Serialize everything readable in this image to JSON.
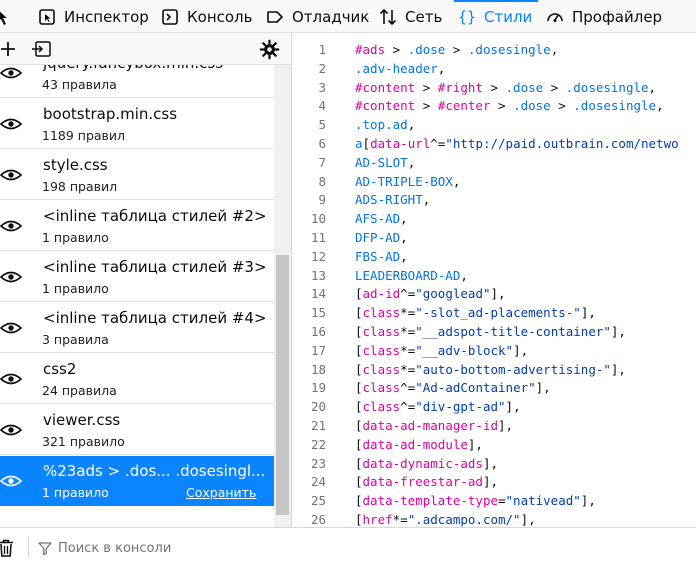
{
  "toolbar": {
    "tabs": [
      {
        "label": "Инспектор",
        "icon": "inspector-icon"
      },
      {
        "label": "Консоль",
        "icon": "console-icon"
      },
      {
        "label": "Отладчик",
        "icon": "debugger-icon"
      },
      {
        "label": "Сеть",
        "icon": "network-icon"
      },
      {
        "label": "Стили",
        "icon": "styles-icon",
        "active": true
      },
      {
        "label": "Профайлер",
        "icon": "profiler-icon"
      }
    ],
    "accent": "#0a84ff"
  },
  "sheets": [
    {
      "name": "jquery.fancybox.min.css",
      "count": "43 правила"
    },
    {
      "name": "bootstrap.min.css",
      "count": "1189 правил"
    },
    {
      "name": "style.css",
      "count": "198 правил"
    },
    {
      "name": "<inline таблица стилей #2>",
      "count": "1 правило"
    },
    {
      "name": "<inline таблица стилей #3>",
      "count": "1 правило"
    },
    {
      "name": "<inline таблица стилей #4>",
      "count": "3 правила"
    },
    {
      "name": "css2",
      "count": "24 правила"
    },
    {
      "name": "viewer.css",
      "count": "321 правило"
    },
    {
      "name": "%23ads > .dos... .dosesingl...",
      "count": "1 правило",
      "save": "Сохранить",
      "selected": true
    }
  ],
  "editor": {
    "lines": [
      {
        "n": "1",
        "parts": [
          [
            "sel",
            "#ads"
          ],
          [
            "op",
            " > "
          ],
          [
            "cls",
            ".dose"
          ],
          [
            "op",
            " > "
          ],
          [
            "cls",
            ".dosesingle"
          ],
          [
            "op",
            ","
          ]
        ]
      },
      {
        "n": "2",
        "parts": [
          [
            "cls",
            ".adv-header"
          ],
          [
            "op",
            ","
          ]
        ]
      },
      {
        "n": "3",
        "parts": [
          [
            "sel",
            "#content"
          ],
          [
            "op",
            " > "
          ],
          [
            "sel",
            "#right"
          ],
          [
            "op",
            " > "
          ],
          [
            "cls",
            ".dose"
          ],
          [
            "op",
            " > "
          ],
          [
            "cls",
            ".dosesingle"
          ],
          [
            "op",
            ","
          ]
        ]
      },
      {
        "n": "4",
        "parts": [
          [
            "sel",
            "#content"
          ],
          [
            "op",
            " > "
          ],
          [
            "sel",
            "#center"
          ],
          [
            "op",
            " > "
          ],
          [
            "cls",
            ".dose"
          ],
          [
            "op",
            " > "
          ],
          [
            "cls",
            ".dosesingle"
          ],
          [
            "op",
            ","
          ]
        ]
      },
      {
        "n": "5",
        "parts": [
          [
            "cls",
            ".top.ad"
          ],
          [
            "op",
            ","
          ]
        ]
      },
      {
        "n": "6",
        "parts": [
          [
            "tag",
            "a"
          ],
          [
            "op",
            "["
          ],
          [
            "attr",
            "data-url"
          ],
          [
            "op",
            "^="
          ],
          [
            "str",
            "\"http://paid.outbrain.com/netwo"
          ]
        ]
      },
      {
        "n": "7",
        "parts": [
          [
            "tag",
            "AD-SLOT"
          ],
          [
            "op",
            ","
          ]
        ]
      },
      {
        "n": "8",
        "parts": [
          [
            "tag",
            "AD-TRIPLE-BOX"
          ],
          [
            "op",
            ","
          ]
        ]
      },
      {
        "n": "9",
        "parts": [
          [
            "tag",
            "ADS-RIGHT"
          ],
          [
            "op",
            ","
          ]
        ]
      },
      {
        "n": "10",
        "parts": [
          [
            "tag",
            "AFS-AD"
          ],
          [
            "op",
            ","
          ]
        ]
      },
      {
        "n": "11",
        "parts": [
          [
            "tag",
            "DFP-AD"
          ],
          [
            "op",
            ","
          ]
        ]
      },
      {
        "n": "12",
        "parts": [
          [
            "tag",
            "FBS-AD"
          ],
          [
            "op",
            ","
          ]
        ]
      },
      {
        "n": "13",
        "parts": [
          [
            "tag",
            "LEADERBOARD-AD"
          ],
          [
            "op",
            ","
          ]
        ]
      },
      {
        "n": "14",
        "parts": [
          [
            "op",
            "["
          ],
          [
            "attr",
            "ad-id"
          ],
          [
            "op",
            "^="
          ],
          [
            "str",
            "\"googlead\""
          ],
          [
            "op",
            "],"
          ]
        ]
      },
      {
        "n": "15",
        "parts": [
          [
            "op",
            "["
          ],
          [
            "attr",
            "class"
          ],
          [
            "op",
            "*="
          ],
          [
            "str",
            "\"-slot_ad-placements-\""
          ],
          [
            "op",
            "],"
          ]
        ]
      },
      {
        "n": "16",
        "parts": [
          [
            "op",
            "["
          ],
          [
            "attr",
            "class"
          ],
          [
            "op",
            "*="
          ],
          [
            "str",
            "\"__adspot-title-container\""
          ],
          [
            "op",
            "],"
          ]
        ]
      },
      {
        "n": "17",
        "parts": [
          [
            "op",
            "["
          ],
          [
            "attr",
            "class"
          ],
          [
            "op",
            "*="
          ],
          [
            "str",
            "\"__adv-block\""
          ],
          [
            "op",
            "],"
          ]
        ]
      },
      {
        "n": "18",
        "parts": [
          [
            "op",
            "["
          ],
          [
            "attr",
            "class"
          ],
          [
            "op",
            "*="
          ],
          [
            "str",
            "\"auto-bottom-advertising-\""
          ],
          [
            "op",
            "],"
          ]
        ]
      },
      {
        "n": "19",
        "parts": [
          [
            "op",
            "["
          ],
          [
            "attr",
            "class"
          ],
          [
            "op",
            "^="
          ],
          [
            "str",
            "\"Ad-adContainer\""
          ],
          [
            "op",
            "],"
          ]
        ]
      },
      {
        "n": "20",
        "parts": [
          [
            "op",
            "["
          ],
          [
            "attr",
            "class"
          ],
          [
            "op",
            "^="
          ],
          [
            "str",
            "\"div-gpt-ad\""
          ],
          [
            "op",
            "],"
          ]
        ]
      },
      {
        "n": "21",
        "parts": [
          [
            "op",
            "["
          ],
          [
            "attr",
            "data-ad-manager-id"
          ],
          [
            "op",
            "],"
          ]
        ]
      },
      {
        "n": "22",
        "parts": [
          [
            "op",
            "["
          ],
          [
            "attr",
            "data-ad-module"
          ],
          [
            "op",
            "],"
          ]
        ]
      },
      {
        "n": "23",
        "parts": [
          [
            "op",
            "["
          ],
          [
            "attr",
            "data-dynamic-ads"
          ],
          [
            "op",
            "],"
          ]
        ]
      },
      {
        "n": "24",
        "parts": [
          [
            "op",
            "["
          ],
          [
            "attr",
            "data-freestar-ad"
          ],
          [
            "op",
            "],"
          ]
        ]
      },
      {
        "n": "25",
        "parts": [
          [
            "op",
            "["
          ],
          [
            "attr",
            "data-template-type"
          ],
          [
            "op",
            "="
          ],
          [
            "str",
            "\"nativead\""
          ],
          [
            "op",
            "],"
          ]
        ]
      },
      {
        "n": "26",
        "parts": [
          [
            "op",
            "["
          ],
          [
            "attr",
            "href"
          ],
          [
            "op",
            "*="
          ],
          [
            "str",
            "\".adcampo.com/\""
          ],
          [
            "op",
            "],"
          ]
        ]
      }
    ]
  },
  "console": {
    "placeholder": "Поиск в консоли"
  }
}
